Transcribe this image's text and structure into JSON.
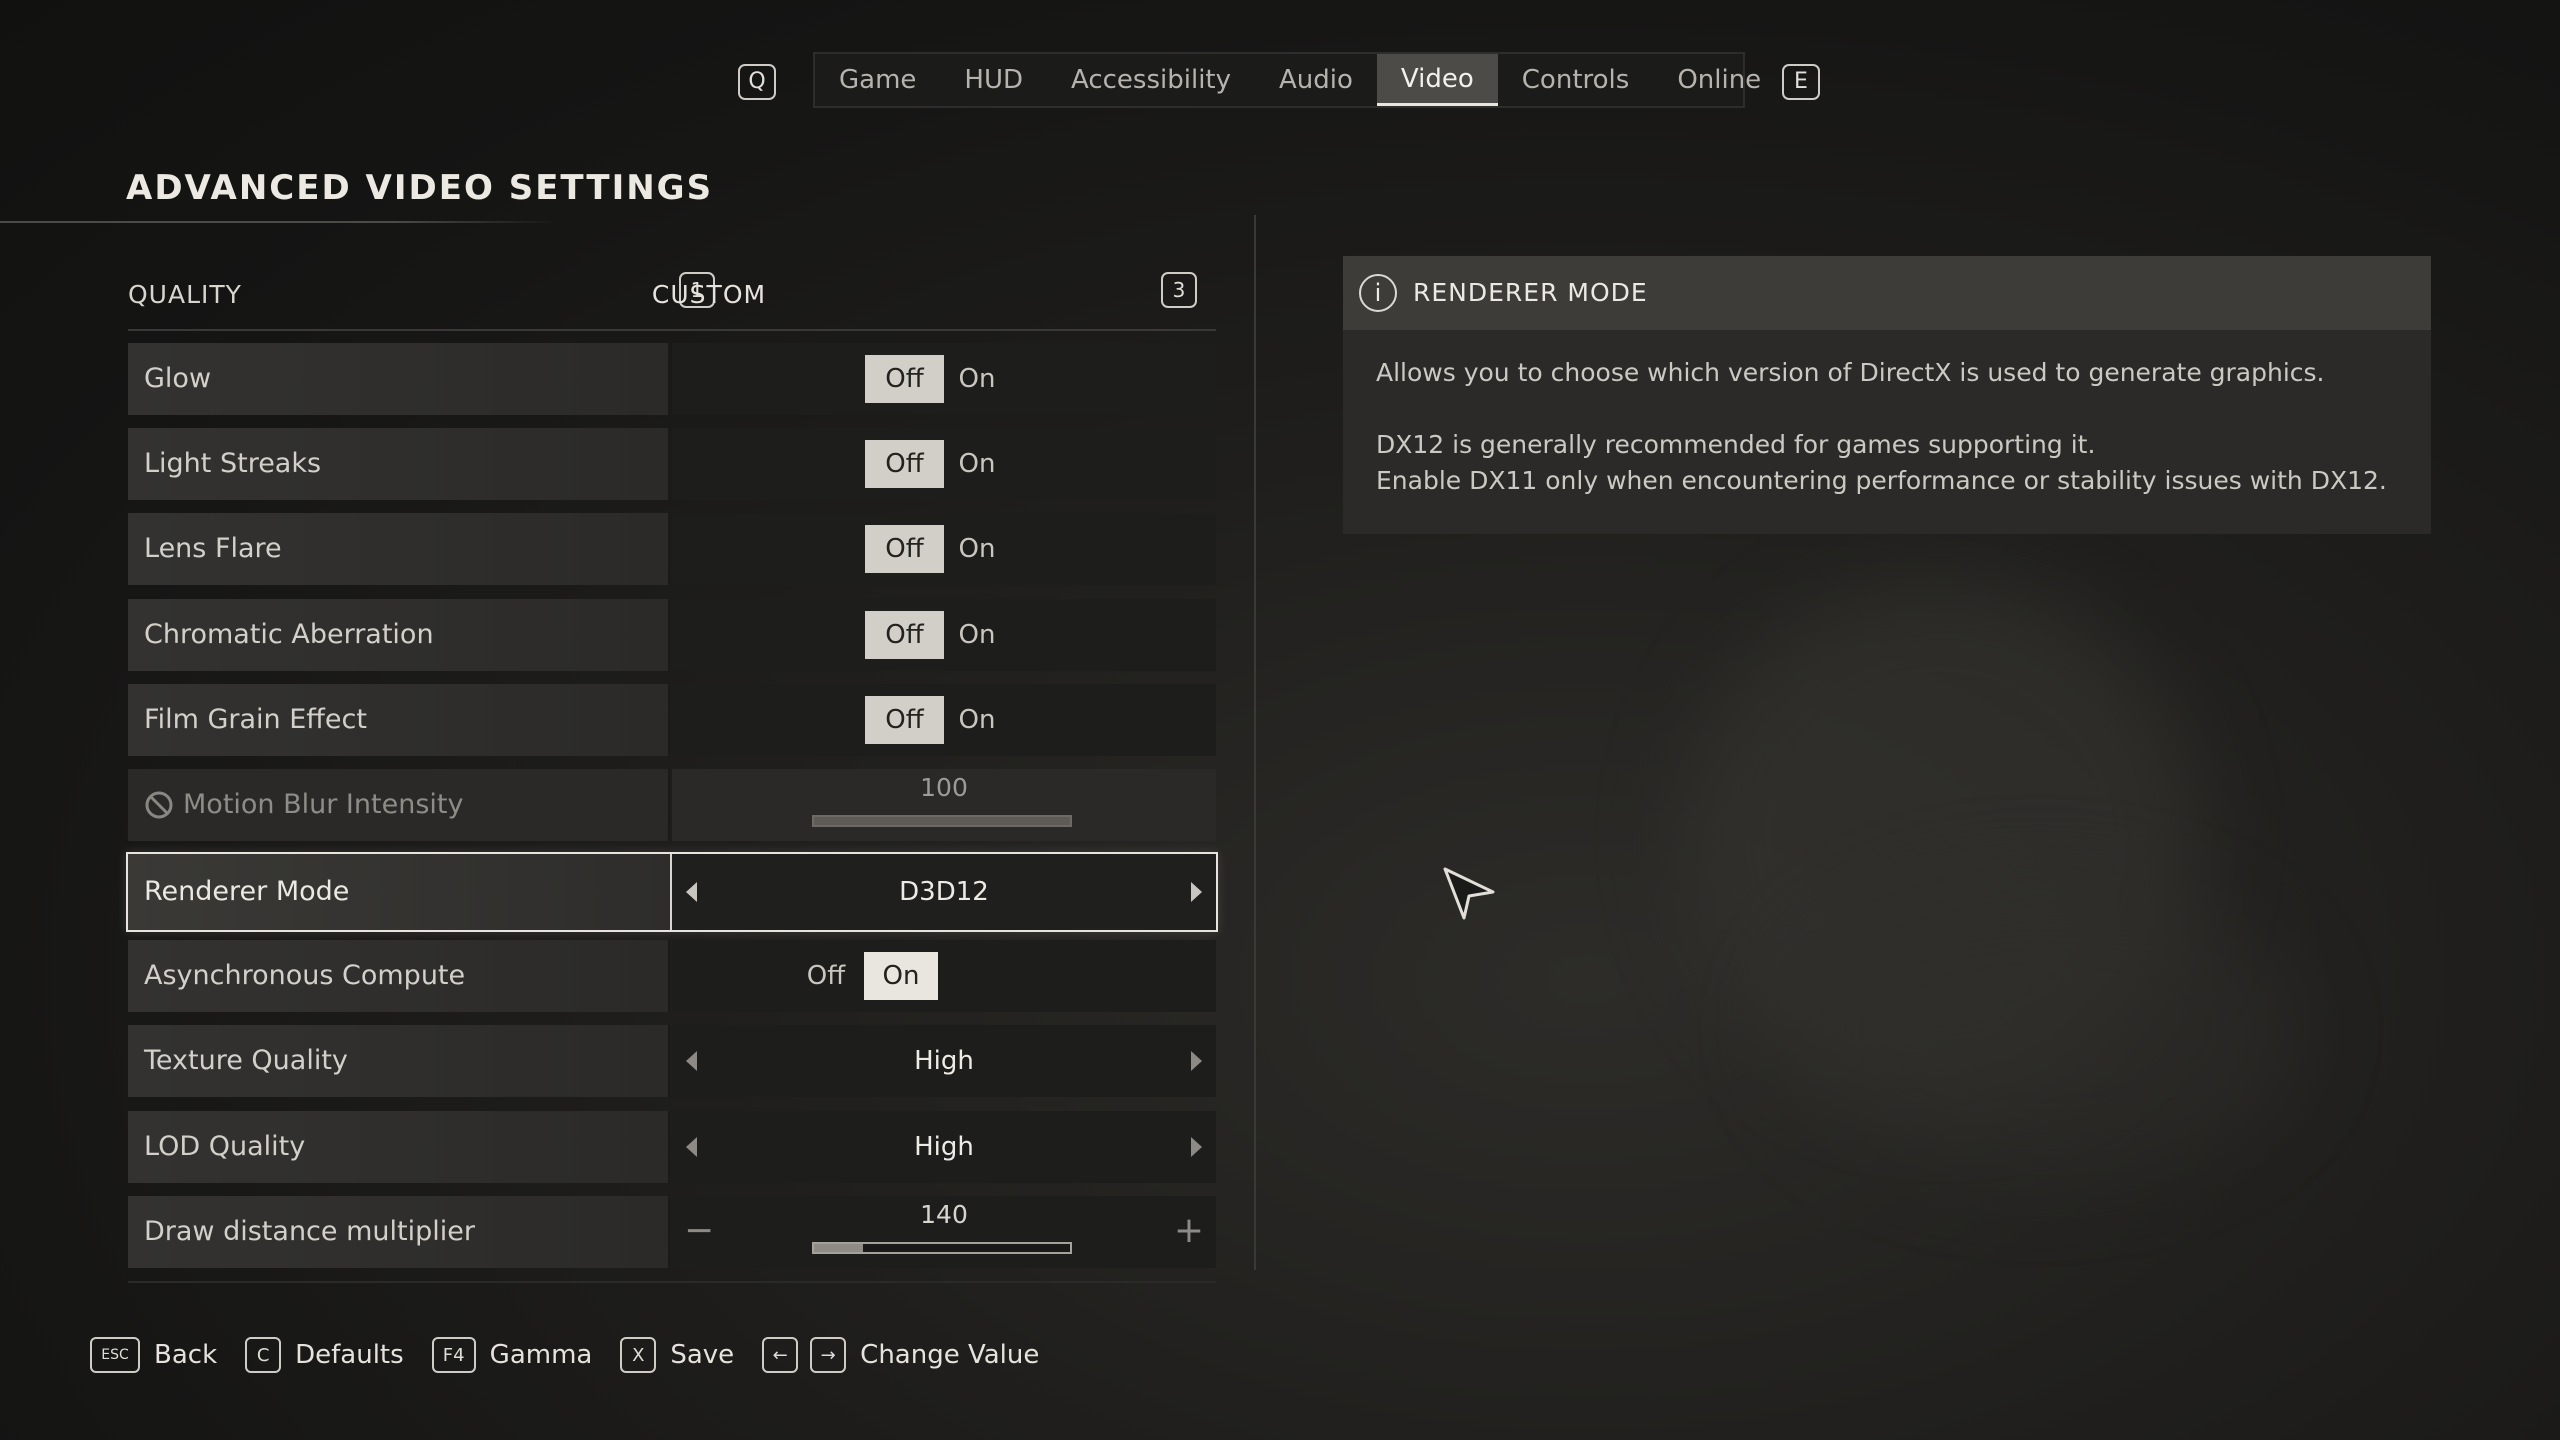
{
  "nav": {
    "prev_key": "Q",
    "next_key": "E",
    "tabs": [
      "Game",
      "HUD",
      "Accessibility",
      "Audio",
      "Video",
      "Controls",
      "Online"
    ],
    "active_tab": "Video"
  },
  "page_title": "ADVANCED VIDEO SETTINGS",
  "quality": {
    "label": "QUALITY",
    "prev_key": "1",
    "value": "CUSTOM",
    "next_key": "3"
  },
  "settings": [
    {
      "label": "Glow",
      "type": "toggle",
      "off": "Off",
      "on": "On",
      "selected": "Off"
    },
    {
      "label": "Light Streaks",
      "type": "toggle",
      "off": "Off",
      "on": "On",
      "selected": "Off"
    },
    {
      "label": "Lens Flare",
      "type": "toggle",
      "off": "Off",
      "on": "On",
      "selected": "Off"
    },
    {
      "label": "Chromatic Aberration",
      "type": "toggle",
      "off": "Off",
      "on": "On",
      "selected": "Off"
    },
    {
      "label": "Film Grain Effect",
      "type": "toggle",
      "off": "Off",
      "on": "On",
      "selected": "Off"
    },
    {
      "label": "Motion Blur Intensity",
      "type": "slider",
      "value": "100",
      "fill_fraction": 1.0,
      "disabled": true
    },
    {
      "label": "Renderer Mode",
      "type": "select",
      "value": "D3D12",
      "focused": true
    },
    {
      "label": "Asynchronous Compute",
      "type": "toggle",
      "off": "Off",
      "on": "On",
      "selected": "On"
    },
    {
      "label": "Texture Quality",
      "type": "select",
      "value": "High"
    },
    {
      "label": "LOD Quality",
      "type": "select",
      "value": "High"
    },
    {
      "label": "Draw distance multiplier",
      "type": "stepper-slider",
      "value": "140",
      "fill_fraction": 0.19
    }
  ],
  "info": {
    "title": "RENDERER MODE",
    "lines": [
      "Allows you to choose which version of DirectX is used to generate graphics.",
      "DX12 is generally recommended for games supporting it.",
      "Enable DX11 only when encountering performance or stability issues with DX12."
    ]
  },
  "footer": [
    {
      "key": "ESC",
      "label": "Back"
    },
    {
      "key": "C",
      "label": "Defaults"
    },
    {
      "key": "F4",
      "label": "Gamma"
    },
    {
      "key": "X",
      "label": "Save"
    },
    {
      "key": "←",
      "key2": "→",
      "label": "Change Value"
    }
  ],
  "colors": {
    "background": "#1f1e1c",
    "accent": "#d2cfc9",
    "panel": "#2b2a28"
  },
  "icons": [
    "disabled-icon",
    "info-icon",
    "arrow-left-icon",
    "arrow-right-icon",
    "minus-icon",
    "plus-icon",
    "mouse-cursor-icon"
  ]
}
